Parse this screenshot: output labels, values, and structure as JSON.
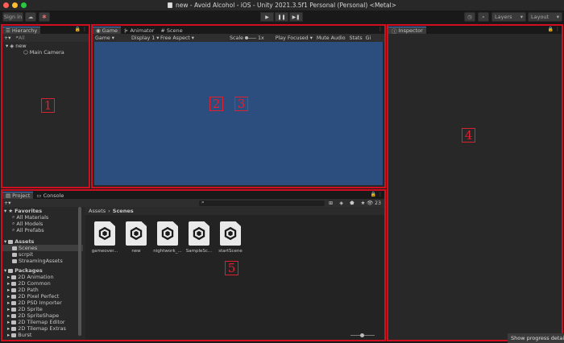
{
  "window": {
    "title": "new - Avoid Alcohol - iOS - Unity 2021.3.5f1 Personal (Personal) <Metal>"
  },
  "toolbar": {
    "signin_label": "Sign in",
    "play_icon": "▶",
    "pause_icon": "❚❚",
    "step_icon": "▶❚",
    "layers_label": "Layers",
    "layout_label": "Layout"
  },
  "hierarchy": {
    "tab_label": "Hierarchy",
    "search_placeholder": "All",
    "items": [
      {
        "label": "new",
        "depth": 0
      },
      {
        "label": "Main Camera",
        "depth": 1
      }
    ],
    "marker": "1"
  },
  "game": {
    "tabs": [
      "Game",
      "Animator",
      "Scene"
    ],
    "subbar": {
      "display_mode": "Game",
      "display": "Display 1",
      "aspect": "Free Aspect",
      "scale_label": "Scale",
      "scale_value": "1x",
      "play_focused": "Play Focused",
      "mute_audio": "Mute Audio",
      "stats": "Stats",
      "gizmos": "Gi"
    },
    "background_color": "#2c4e7e",
    "markers": [
      "2",
      "3"
    ]
  },
  "inspector": {
    "tab_label": "Inspector",
    "marker": "4"
  },
  "project": {
    "tabs": [
      "Project",
      "Console"
    ],
    "asset_count": "23",
    "breadcrumb": {
      "root": "Assets",
      "current": "Scenes"
    },
    "sidebar": {
      "favorites_label": "Favorites",
      "favorites": [
        "All Materials",
        "All Models",
        "All Prefabs"
      ],
      "assets_label": "Assets",
      "assets": [
        "Scenes",
        "scrpit",
        "StreamingAssets"
      ],
      "packages_label": "Packages",
      "packages": [
        "2D Animation",
        "2D Common",
        "2D Path",
        "2D Pixel Perfect",
        "2D PSD Importer",
        "2D Sprite",
        "2D SpriteShape",
        "2D Tilemap Editor",
        "2D Tilemap Extras",
        "Burst"
      ]
    },
    "assets": [
      {
        "label": "gameover..."
      },
      {
        "label": "new"
      },
      {
        "label": "nightwork_..."
      },
      {
        "label": "SampleSc..."
      },
      {
        "label": "startScene"
      }
    ],
    "marker": "5"
  },
  "status": {
    "progress_tip": "Show progress detail"
  },
  "colors": {
    "highlight_border": "#d01020",
    "active_tab_accent": "#3a72c4"
  }
}
